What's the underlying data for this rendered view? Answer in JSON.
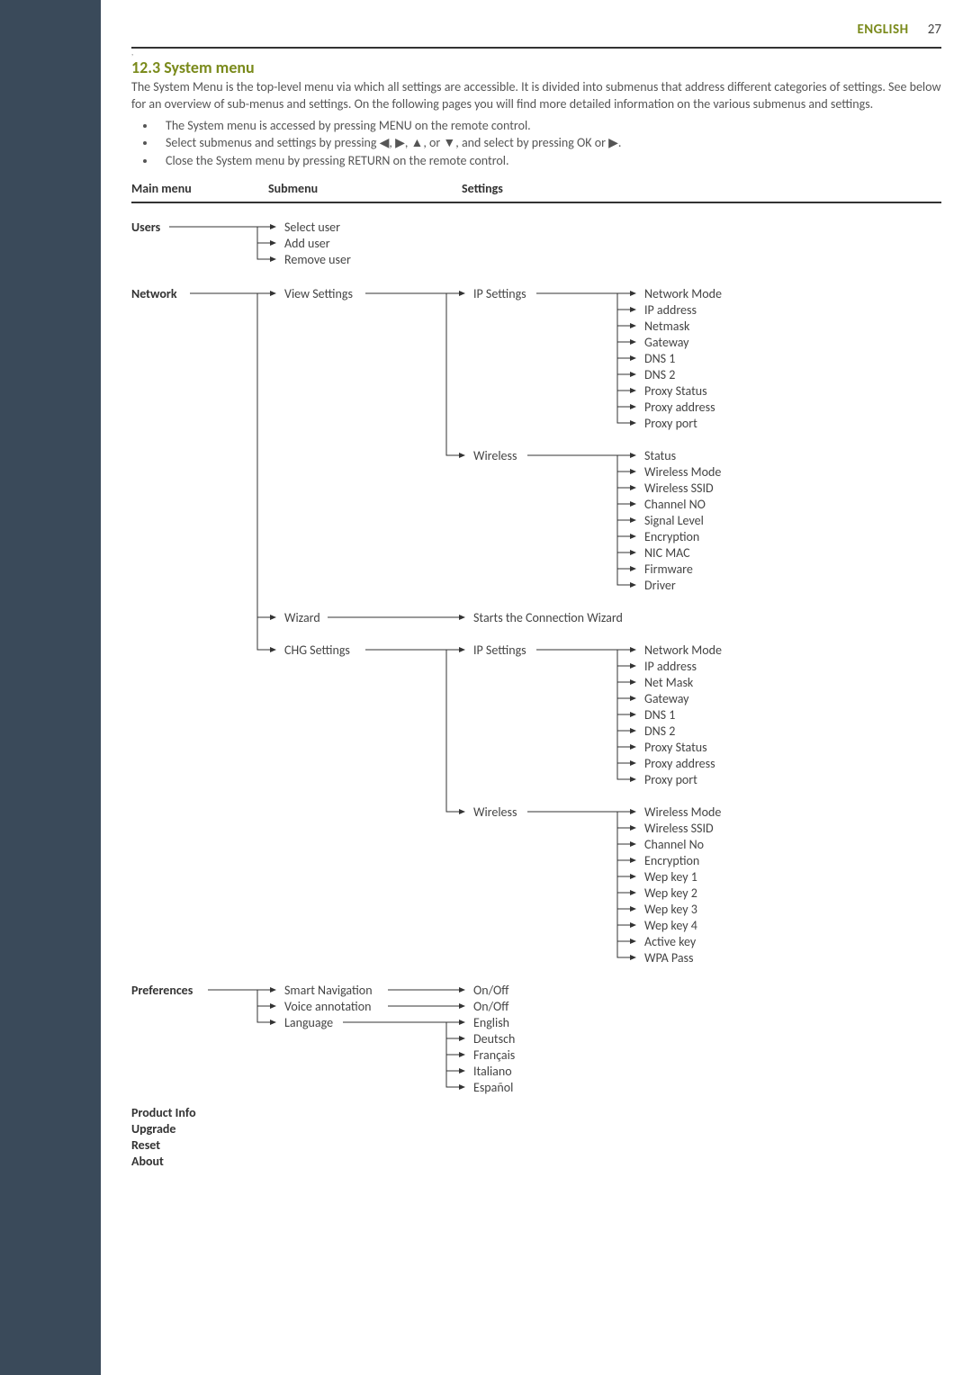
{
  "header": {
    "lang": "ENGLISH",
    "page": "27"
  },
  "section": {
    "title": "12.3 System menu",
    "intro": "The System Menu is the top-level menu via which all settings are accessible. It is divided into submenus that address different categories of settings. See below for an overview of sub-menus and settings. On the following pages you will find more detailed information on the various submenus and settings.",
    "bullets": [
      "The System menu is accessed by pressing MENU on the remote control.",
      "Select submenus and settings by pressing ◀, ▶, ▲, or ▼, and select by pressing OK or ▶.",
      "Close the System menu by pressing RETURN on the remote control."
    ]
  },
  "cols": {
    "main": "Main menu",
    "sub": "Submenu",
    "set": "Settings"
  },
  "tree": {
    "users": {
      "label": "Users",
      "items": [
        "Select user",
        "Add user",
        "Remove user"
      ]
    },
    "network": {
      "label": "Network",
      "view": {
        "label": "View Settings",
        "ip": {
          "label": "IP Settings",
          "items": [
            "Network Mode",
            "IP address",
            "Netmask",
            "Gateway",
            "DNS 1",
            "DNS 2",
            "Proxy Status",
            "Proxy address",
            "Proxy port"
          ]
        },
        "wl": {
          "label": "Wireless",
          "items": [
            "Status",
            "Wireless Mode",
            "Wireless SSID",
            "Channel NO",
            "Signal Level",
            "Encryption",
            "NIC MAC",
            "Firmware",
            "Driver"
          ]
        }
      },
      "wizard": {
        "label": "Wizard",
        "text": "Starts the Connection Wizard"
      },
      "chg": {
        "label": "CHG Settings",
        "ip": {
          "label": "IP Settings",
          "items": [
            "Network Mode",
            "IP address",
            "Net Mask",
            "Gateway",
            "DNS 1",
            "DNS 2",
            "Proxy Status",
            "Proxy address",
            "Proxy port"
          ]
        },
        "wl": {
          "label": "Wireless",
          "items": [
            "Wireless Mode",
            "Wireless SSID",
            "Channel No",
            "Encryption",
            "Wep key 1",
            "Wep key 2",
            "Wep key 3",
            "Wep key 4",
            "Active key",
            "WPA Pass"
          ]
        }
      }
    },
    "prefs": {
      "label": "Preferences",
      "smart": {
        "label": "Smart Navigation",
        "opt": "On/Off"
      },
      "voice": {
        "label": "Voice annotation",
        "opt": "On/Off"
      },
      "lang": {
        "label": "Language",
        "opts": [
          "English",
          "Deutsch",
          "Français",
          "Italiano",
          "Español"
        ]
      }
    },
    "tail": [
      "Product Info",
      "Upgrade",
      "Reset",
      "About"
    ]
  }
}
